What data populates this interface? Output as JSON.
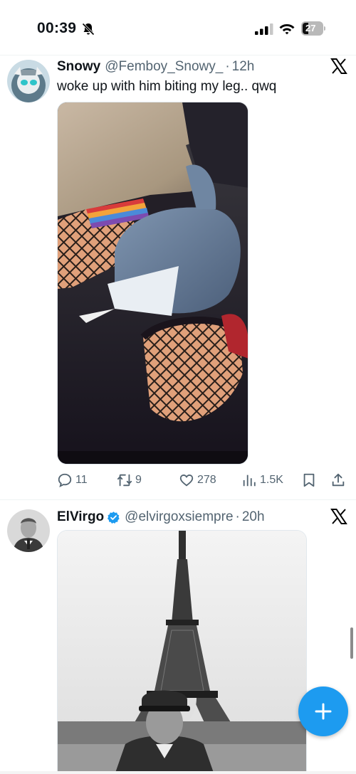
{
  "status_bar": {
    "time": "00:39",
    "battery_level": "27",
    "icons": [
      "bell-slash-icon",
      "cellular-signal-icon",
      "wifi-icon",
      "battery-icon"
    ]
  },
  "tweets": [
    {
      "display_name": "Snowy",
      "handle": "@Femboy_Snowy_",
      "separator": "·",
      "time": "12h",
      "text": "woke up with him biting my leg.. qwq",
      "verified": false,
      "media_icon": "photo",
      "actions": {
        "replies": "11",
        "retweets": "9",
        "likes": "278",
        "views": "1.5K"
      }
    },
    {
      "display_name": "ElVirgo",
      "handle": "@elvirgoxsiempre",
      "separator": "·",
      "time": "20h",
      "verified": true,
      "media_icon": "photo"
    }
  ],
  "colors": {
    "accent": "#1d9bf0",
    "text_primary": "#0f1419",
    "text_secondary": "#536471",
    "divider": "#eff3f4"
  },
  "fab": {
    "icon": "plus-icon"
  }
}
